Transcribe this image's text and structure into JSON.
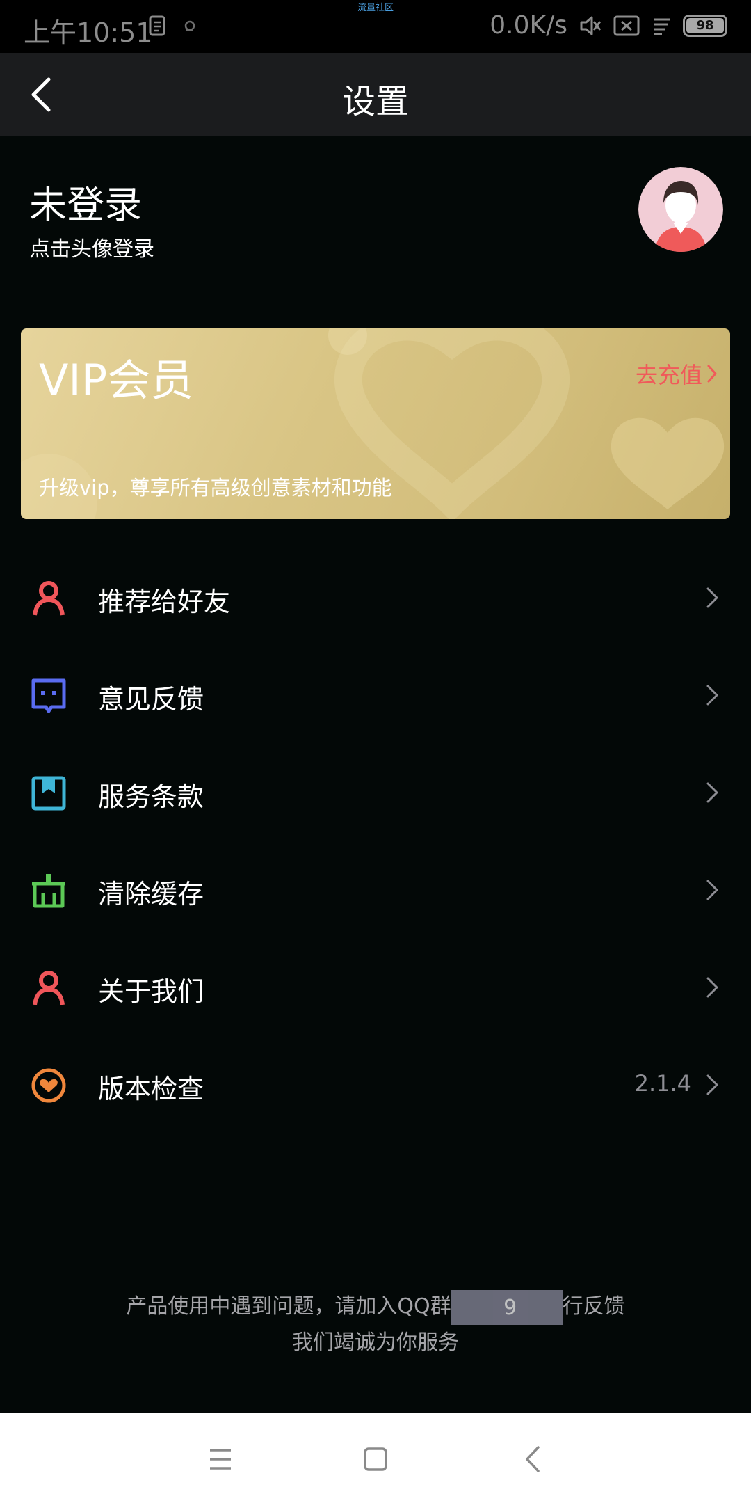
{
  "status_bar": {
    "watermark": "流量社区",
    "time": "上午10:51",
    "net_speed": "0.0K/s",
    "battery": "98"
  },
  "header": {
    "title": "设置"
  },
  "profile": {
    "name": "未登录",
    "hint": "点击头像登录"
  },
  "vip": {
    "title": "VIP会员",
    "link_label": "去充值",
    "description": "升级vip，尊享所有高级创意素材和功能",
    "accent_color": "#f05a5a"
  },
  "menu": [
    {
      "label": "推荐给好友",
      "icon": "person-icon",
      "color": "#f0565a"
    },
    {
      "label": "意见反馈",
      "icon": "feedback-chat-icon",
      "color": "#5a6cf0"
    },
    {
      "label": "服务条款",
      "icon": "bookmark-icon",
      "color": "#3fb5d6"
    },
    {
      "label": "清除缓存",
      "icon": "broom-icon",
      "color": "#5cc956"
    },
    {
      "label": "关于我们",
      "icon": "person-icon",
      "color": "#f0565a"
    },
    {
      "label": "版本检查",
      "icon": "version-heart-icon",
      "color": "#f0873c",
      "value": "2.1.4"
    }
  ],
  "footer": {
    "line1_a": "产品使用中遇到问题，请加入QQ群",
    "line1_b": "9",
    "line1_c": "行反馈",
    "line2": "我们竭诚为你服务"
  }
}
